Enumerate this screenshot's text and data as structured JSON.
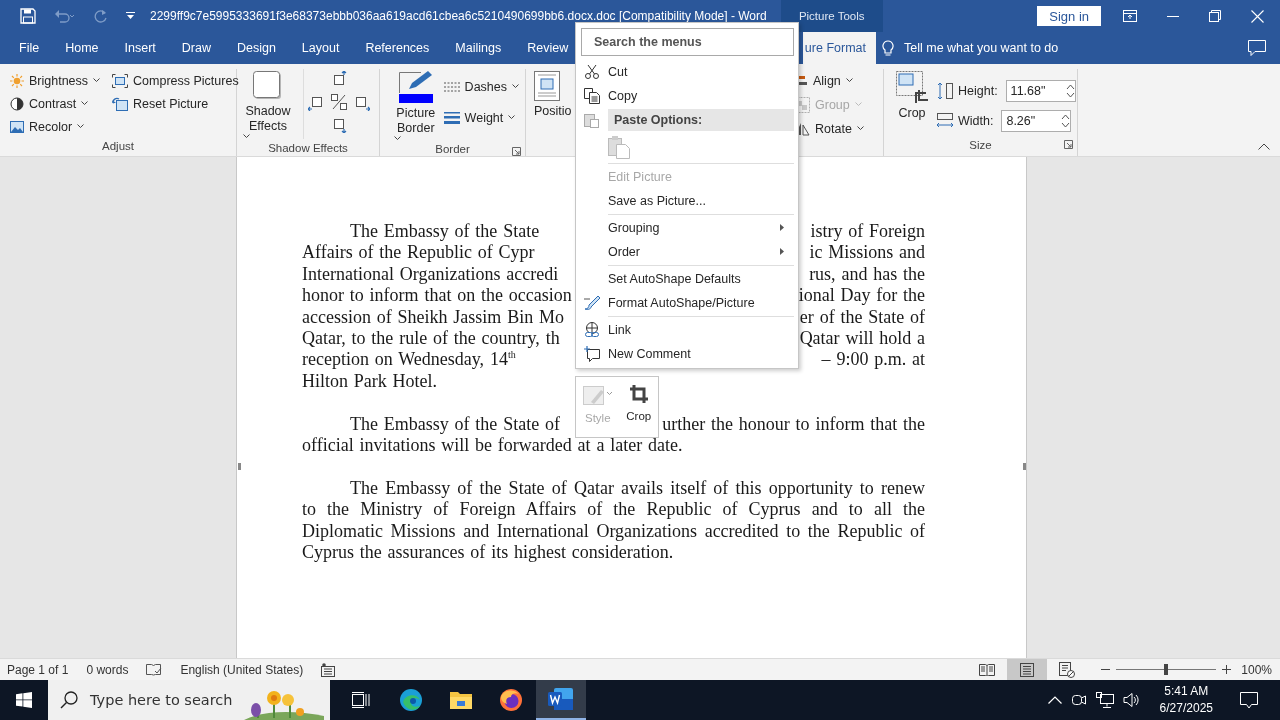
{
  "title_bar": {
    "title": "2299ff9c7e5995333691f3e68373ebbb036aa619acd61cbea6c5210490699bb6.docx.doc [Compatibility Mode]  -  Word",
    "context_header": "Picture Tools",
    "sign_in": "Sign in"
  },
  "tabs": [
    {
      "label": "File",
      "selected": false
    },
    {
      "label": "Home",
      "selected": false
    },
    {
      "label": "Insert",
      "selected": false
    },
    {
      "label": "Draw",
      "selected": false
    },
    {
      "label": "Design",
      "selected": false
    },
    {
      "label": "Layout",
      "selected": false
    },
    {
      "label": "References",
      "selected": false
    },
    {
      "label": "Mailings",
      "selected": false
    },
    {
      "label": "Review",
      "selected": false
    },
    {
      "label": "ure Format",
      "selected": true
    }
  ],
  "tell_me": {
    "placeholder": "Tell me what you want to do"
  },
  "ribbon": {
    "adjust": {
      "label": "Adjust",
      "items": [
        {
          "label": "Brightness",
          "dropdown": true
        },
        {
          "label": "Contrast",
          "dropdown": true
        },
        {
          "label": "Recolor",
          "dropdown": true
        },
        {
          "label": "Compress Pictures",
          "dropdown": false
        },
        {
          "label": "Reset Picture",
          "dropdown": false
        }
      ]
    },
    "shadow": {
      "label": "Shadow Effects",
      "button": "Shadow Effects"
    },
    "border": {
      "label": "Border",
      "button": "Picture Border",
      "items": [
        {
          "label": "Dashes",
          "dropdown": true
        },
        {
          "label": "Weight",
          "dropdown": true
        }
      ]
    },
    "arrange": {
      "position": "Positio",
      "items": [
        {
          "label": "Align",
          "disabled": false
        },
        {
          "label": "Group",
          "disabled": true
        },
        {
          "label": "Rotate",
          "disabled": false
        }
      ]
    },
    "size": {
      "label": "Size",
      "crop": "Crop",
      "fields": [
        {
          "label": "Height:",
          "value": "11.68\""
        },
        {
          "label": "Width:",
          "value": "8.26\""
        }
      ]
    }
  },
  "document": {
    "paragraphs": [
      {
        "lines": [
          {
            "left": "The Embassy of the State",
            "right": "istry of Foreign"
          },
          {
            "left": "Affairs of the Republic of Cypr",
            "right": "ic Missions and"
          },
          {
            "left": "International Organizations accredi",
            "right": "rus, and has the"
          },
          {
            "left": "honor to inform that on the occasion",
            "right": "ional Day for the"
          },
          {
            "left": "accession of Sheikh Jassim Bin Mo",
            "right": "er of the State of"
          },
          {
            "left": "Qatar, to the rule of the country, th",
            "right": "Qatar will hold a"
          },
          {
            "left": "reception on Wednesday, 14$^{th}$",
            "right": "– 9:00 p.m. at"
          },
          {
            "left": "Hilton Park Hotel."
          }
        ]
      },
      {
        "lines": [
          {
            "left": "The Embassy of the State of",
            "right": "urther the honour to inform that the"
          },
          {
            "left": "official invitations will be forwarded at a later date."
          }
        ]
      },
      {
        "text": "The Embassy of the State of Qatar avails itself of this opportunity to renew to the Ministry of Foreign Affairs of the Republic of Cyprus and to all the Diplomatic Missions and International Organizations accredited to the Republic of Cyprus the assurances of its highest consideration."
      }
    ]
  },
  "context_menu": {
    "search": {
      "placeholder": "Search the menus"
    },
    "items": [
      {
        "kind": "item",
        "label": "Cut",
        "disabled": false
      },
      {
        "kind": "item",
        "label": "Copy",
        "disabled": false
      },
      {
        "kind": "header",
        "label": "Paste Options:"
      },
      {
        "kind": "paste"
      },
      {
        "kind": "separator"
      },
      {
        "kind": "item",
        "label": "Edit Picture",
        "disabled": true
      },
      {
        "kind": "item",
        "label": "Save as Picture...",
        "disabled": false
      },
      {
        "kind": "separator"
      },
      {
        "kind": "item",
        "label": "Grouping",
        "disabled": false,
        "submenu": true
      },
      {
        "kind": "item",
        "label": "Order",
        "disabled": false,
        "submenu": true
      },
      {
        "kind": "separator"
      },
      {
        "kind": "item",
        "label": "Set AutoShape Defaults",
        "disabled": false
      },
      {
        "kind": "item",
        "label": "Format AutoShape/Picture",
        "disabled": false
      },
      {
        "kind": "separator"
      },
      {
        "kind": "item",
        "label": "Link",
        "disabled": false
      },
      {
        "kind": "item",
        "label": "New Comment",
        "disabled": false
      }
    ]
  },
  "mini_toolbar": {
    "buttons": [
      {
        "label": "Style",
        "disabled": true
      },
      {
        "label": "Crop",
        "disabled": false
      }
    ]
  },
  "status_bar": {
    "page": "Page 1 of 1",
    "words": "0 words",
    "language": "English (United States)",
    "views": [
      {
        "selected": false
      },
      {
        "selected": true
      },
      {
        "selected": false
      }
    ],
    "zoom": {
      "level": 0.5,
      "reading": "100%"
    }
  },
  "taskbar": {
    "search": {
      "placeholder": "Type here to search"
    },
    "apps": [
      {
        "selected": false
      },
      {
        "selected": false
      },
      {
        "selected": false
      },
      {
        "selected": false
      },
      {
        "selected": true
      }
    ],
    "time": "5:41 AM",
    "date": "6/27/2025"
  }
}
